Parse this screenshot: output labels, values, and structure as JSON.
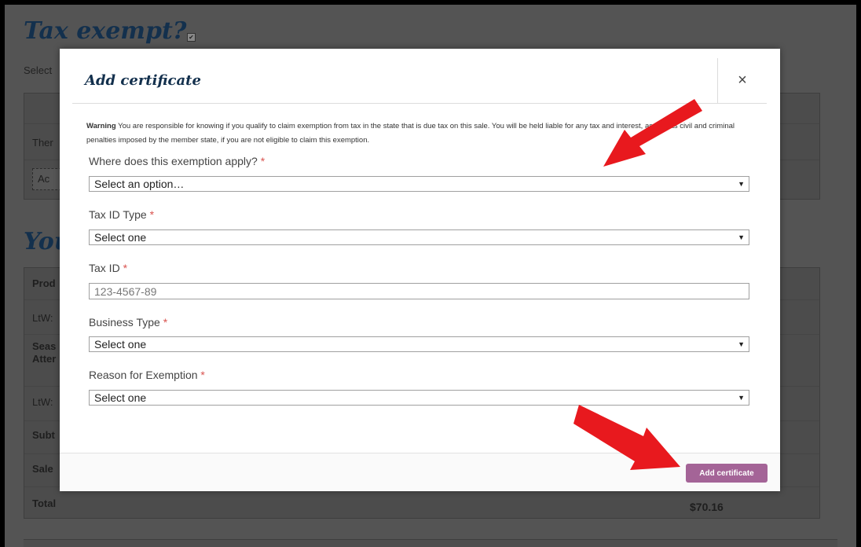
{
  "page": {
    "title": "Tax exempt?",
    "checkbox_mark": "✔",
    "select_text": "Select",
    "rows": {
      "there": "Ther",
      "add_btn": "Ac",
      "heading2": "You",
      "product": "Prod",
      "ltw1": "LtW:",
      "seas": "Seas",
      "atter": "Atter",
      "ltw2": "LtW:",
      "subtotal": "Subt",
      "sales": "Sale",
      "total": "Total"
    },
    "total_amount": "$70.16"
  },
  "modal": {
    "title": "Add certificate",
    "close_label": "×",
    "warning_label": "Warning",
    "warning_text": " You are responsible for knowing if you qualify to claim exemption from tax in the state that is due tax on this sale. You will be held liable for any tax and interest, as well as civil and criminal penalties imposed by the member state, if you are not eligible to claim this exemption.",
    "required_mark": "*",
    "caret": "▼",
    "fields": {
      "exemption_location": {
        "label": "Where does this exemption apply?",
        "value": "Select an option…"
      },
      "tax_id_type": {
        "label": "Tax ID Type",
        "value": "Select one"
      },
      "tax_id": {
        "label": "Tax ID",
        "placeholder": "123-4567-89"
      },
      "business_type": {
        "label": "Business Type",
        "value": "Select one"
      },
      "reason": {
        "label": "Reason for Exemption",
        "value": "Select one"
      }
    },
    "submit_label": "Add certificate"
  },
  "annotations": {
    "arrow_color": "#e8191e"
  }
}
